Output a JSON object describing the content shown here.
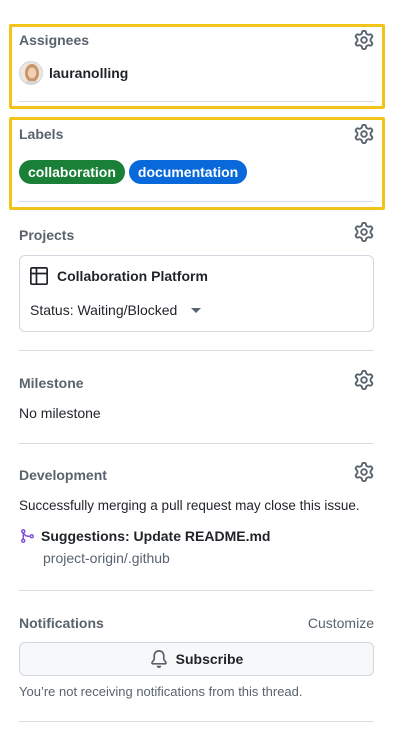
{
  "assignees": {
    "heading": "Assignees",
    "user": "lauranolling"
  },
  "labels": {
    "heading": "Labels",
    "items": [
      {
        "name": "collaboration",
        "color": "#1a7f37"
      },
      {
        "name": "documentation",
        "color": "#0969da"
      }
    ]
  },
  "projects": {
    "heading": "Projects",
    "project_name": "Collaboration Platform",
    "status": "Status: Waiting/Blocked"
  },
  "milestone": {
    "heading": "Milestone",
    "value": "No milestone"
  },
  "development": {
    "heading": "Development",
    "description": "Successfully merging a pull request may close this issue.",
    "pr_title": "Suggestions: Update README.md",
    "pr_repo": "project-origin/.github"
  },
  "notifications": {
    "heading": "Notifications",
    "customize": "Customize",
    "subscribe": "Subscribe",
    "note": "You’re not receiving notifications from this thread."
  },
  "colors": {
    "highlight": "#f0c419",
    "label_green": "#1a7f37",
    "label_blue": "#0969da",
    "pr_icon": "#8250df"
  }
}
